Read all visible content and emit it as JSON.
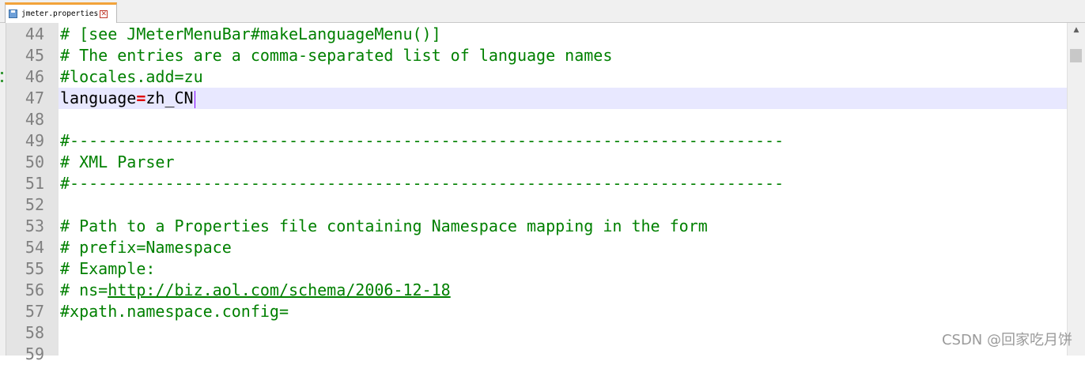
{
  "tab": {
    "filename": "jmeter.properties",
    "save_icon": "save-icon",
    "close_icon": "close-icon"
  },
  "editor": {
    "current_line": 47,
    "lines": [
      {
        "num": "44",
        "segments": [
          {
            "t": "# [see JMeterMenuBar#makeLanguageMenu()]",
            "c": "comment"
          }
        ]
      },
      {
        "num": "45",
        "segments": [
          {
            "t": "# The entries are a comma-separated list of language names",
            "c": "comment"
          }
        ]
      },
      {
        "num": "46",
        "segments": [
          {
            "t": "#locales.add=zu",
            "c": "comment"
          }
        ]
      },
      {
        "num": "47",
        "segments": [
          {
            "t": "language",
            "c": "plain"
          },
          {
            "t": "=",
            "c": "op"
          },
          {
            "t": "zh_CN",
            "c": "plain"
          }
        ]
      },
      {
        "num": "48",
        "segments": []
      },
      {
        "num": "49",
        "segments": [
          {
            "t": "#---------------------------------------------------------------------------",
            "c": "comment"
          }
        ]
      },
      {
        "num": "50",
        "segments": [
          {
            "t": "# XML Parser",
            "c": "comment"
          }
        ]
      },
      {
        "num": "51",
        "segments": [
          {
            "t": "#---------------------------------------------------------------------------",
            "c": "comment"
          }
        ]
      },
      {
        "num": "52",
        "segments": []
      },
      {
        "num": "53",
        "segments": [
          {
            "t": "# Path to a Properties file containing Namespace mapping in the form",
            "c": "comment"
          }
        ]
      },
      {
        "num": "54",
        "segments": [
          {
            "t": "# prefix=Namespace",
            "c": "comment"
          }
        ]
      },
      {
        "num": "55",
        "segments": [
          {
            "t": "# Example:",
            "c": "comment"
          }
        ]
      },
      {
        "num": "56",
        "segments": [
          {
            "t": "# ns=",
            "c": "comment"
          },
          {
            "t": "http://biz.aol.com/schema/2006-12-18",
            "c": "link"
          }
        ]
      },
      {
        "num": "57",
        "segments": [
          {
            "t": "#xpath.namespace.config=",
            "c": "comment"
          }
        ]
      },
      {
        "num": "58",
        "segments": []
      },
      {
        "num": "59",
        "segments": []
      }
    ]
  },
  "colors": {
    "comment": "#008000",
    "operator": "#e00000",
    "current_line_bg": "#e8e8ff",
    "tab_accent": "#f2a33a"
  },
  "scrollbar": {
    "up_icon": "scroll-up-arrow-icon"
  },
  "watermark": "CSDN @回家吃月饼"
}
